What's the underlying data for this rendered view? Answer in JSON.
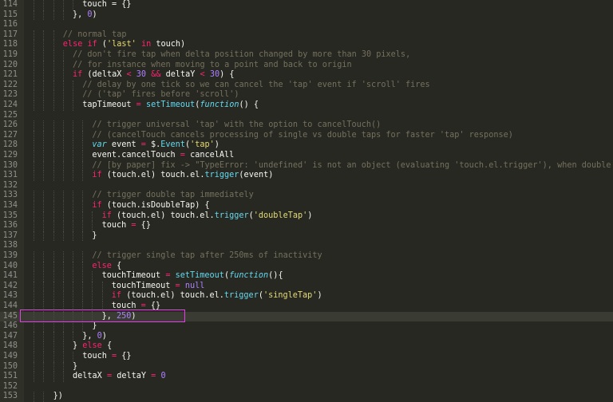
{
  "editor": {
    "theme": {
      "background": "#272822",
      "text": "#f8f8f2",
      "comment": "#75715e",
      "keyword": "#f92672",
      "string": "#e6db74",
      "number": "#ae81ff",
      "function": "#66d9ef",
      "highlight_box": "#e43ee8"
    },
    "lines": [
      {
        "n": "114",
        "i": 6,
        "t": [
          [
            "",
            "touch = {}"
          ]
        ]
      },
      {
        "n": "115",
        "i": 5,
        "t": [
          [
            "",
            "}, "
          ],
          [
            "number",
            "0"
          ],
          [
            "",
            ")"
          ]
        ]
      },
      {
        "n": "116",
        "i": 0,
        "t": []
      },
      {
        "n": "117",
        "i": 4,
        "t": [
          [
            "comment",
            "// normal tap"
          ]
        ]
      },
      {
        "n": "118",
        "i": 4,
        "t": [
          [
            "keyword",
            "else if"
          ],
          [
            "",
            " ("
          ],
          [
            "string",
            "'last'"
          ],
          [
            "",
            " "
          ],
          [
            "keyword",
            "in"
          ],
          [
            "",
            " touch)"
          ]
        ]
      },
      {
        "n": "119",
        "i": 5,
        "t": [
          [
            "comment",
            "// don't fire tap when delta position changed by more than 30 pixels,"
          ]
        ]
      },
      {
        "n": "120",
        "i": 5,
        "t": [
          [
            "comment",
            "// for instance when moving to a point and back to origin"
          ]
        ]
      },
      {
        "n": "121",
        "i": 5,
        "t": [
          [
            "keyword",
            "if"
          ],
          [
            "",
            " (deltaX "
          ],
          [
            "keyword",
            "<"
          ],
          [
            "",
            " "
          ],
          [
            "number",
            "30"
          ],
          [
            "",
            " "
          ],
          [
            "keyword",
            "&&"
          ],
          [
            "",
            " deltaY "
          ],
          [
            "keyword",
            "<"
          ],
          [
            "",
            " "
          ],
          [
            "number",
            "30"
          ],
          [
            "",
            ") {"
          ]
        ]
      },
      {
        "n": "122",
        "i": 6,
        "t": [
          [
            "comment",
            "// delay by one tick so we can cancel the 'tap' event if 'scroll' fires"
          ]
        ]
      },
      {
        "n": "123",
        "i": 6,
        "t": [
          [
            "comment",
            "// ('tap' fires before 'scroll')"
          ]
        ]
      },
      {
        "n": "124",
        "i": 6,
        "t": [
          [
            "",
            "tapTimeout "
          ],
          [
            "keyword",
            "="
          ],
          [
            "",
            " "
          ],
          [
            "func",
            "setTimeout"
          ],
          [
            "",
            "("
          ],
          [
            "storage",
            "function"
          ],
          [
            "",
            "() {"
          ]
        ]
      },
      {
        "n": "125",
        "i": 0,
        "t": []
      },
      {
        "n": "126",
        "i": 7,
        "t": [
          [
            "comment",
            "// trigger universal 'tap' with the option to cancelTouch()"
          ]
        ]
      },
      {
        "n": "127",
        "i": 7,
        "t": [
          [
            "comment",
            "// (cancelTouch cancels processing of single vs double taps for faster 'tap' response)"
          ]
        ]
      },
      {
        "n": "128",
        "i": 7,
        "t": [
          [
            "storage",
            "var"
          ],
          [
            "",
            " event "
          ],
          [
            "keyword",
            "="
          ],
          [
            "",
            " $."
          ],
          [
            "func",
            "Event"
          ],
          [
            "",
            "("
          ],
          [
            "string",
            "'tap'"
          ],
          [
            "",
            ")"
          ]
        ]
      },
      {
        "n": "129",
        "i": 7,
        "t": [
          [
            "",
            "event.cancelTouch "
          ],
          [
            "keyword",
            "="
          ],
          [
            "",
            " cancelAll"
          ]
        ]
      },
      {
        "n": "130",
        "i": 7,
        "t": [
          [
            "comment",
            "// [by paper] fix -> \"TypeError: 'undefined' is not an object (evaluating 'touch.el.trigger'), when double tap"
          ]
        ]
      },
      {
        "n": "131",
        "i": 7,
        "t": [
          [
            "keyword",
            "if"
          ],
          [
            "",
            " (touch.el) touch.el."
          ],
          [
            "func",
            "trigger"
          ],
          [
            "",
            "(event)"
          ]
        ]
      },
      {
        "n": "132",
        "i": 0,
        "t": []
      },
      {
        "n": "133",
        "i": 7,
        "t": [
          [
            "comment",
            "// trigger double tap immediately"
          ]
        ]
      },
      {
        "n": "134",
        "i": 7,
        "t": [
          [
            "keyword",
            "if"
          ],
          [
            "",
            " (touch.isDoubleTap) {"
          ]
        ]
      },
      {
        "n": "135",
        "i": 8,
        "t": [
          [
            "keyword",
            "if"
          ],
          [
            "",
            " (touch.el) touch.el."
          ],
          [
            "func",
            "trigger"
          ],
          [
            "",
            "("
          ],
          [
            "string",
            "'doubleTap'"
          ],
          [
            "",
            ")"
          ]
        ]
      },
      {
        "n": "136",
        "i": 8,
        "t": [
          [
            "",
            "touch "
          ],
          [
            "keyword",
            "="
          ],
          [
            "",
            " {}"
          ]
        ]
      },
      {
        "n": "137",
        "i": 7,
        "t": [
          [
            "",
            "}"
          ]
        ]
      },
      {
        "n": "138",
        "i": 0,
        "t": []
      },
      {
        "n": "139",
        "i": 7,
        "t": [
          [
            "comment",
            "// trigger single tap after 250ms of inactivity"
          ]
        ]
      },
      {
        "n": "140",
        "i": 7,
        "t": [
          [
            "keyword",
            "else"
          ],
          [
            "",
            " {"
          ]
        ]
      },
      {
        "n": "141",
        "i": 8,
        "t": [
          [
            "",
            "touchTimeout "
          ],
          [
            "keyword",
            "="
          ],
          [
            "",
            " "
          ],
          [
            "func",
            "setTimeout"
          ],
          [
            "",
            "("
          ],
          [
            "storage",
            "function"
          ],
          [
            "",
            "(){"
          ]
        ]
      },
      {
        "n": "142",
        "i": 9,
        "t": [
          [
            "",
            "touchTimeout "
          ],
          [
            "keyword",
            "="
          ],
          [
            "",
            " "
          ],
          [
            "number",
            "null"
          ]
        ]
      },
      {
        "n": "143",
        "i": 9,
        "t": [
          [
            "keyword",
            "if"
          ],
          [
            "",
            " (touch.el) touch.el."
          ],
          [
            "func",
            "trigger"
          ],
          [
            "",
            "("
          ],
          [
            "string",
            "'singleTap'"
          ],
          [
            "",
            ")"
          ]
        ]
      },
      {
        "n": "144",
        "i": 9,
        "t": [
          [
            "",
            "touch "
          ],
          [
            "keyword",
            "="
          ],
          [
            "",
            " {}"
          ]
        ]
      },
      {
        "n": "145",
        "i": 8,
        "t": [
          [
            "",
            "}, "
          ],
          [
            "number",
            "250"
          ],
          [
            "",
            ")"
          ]
        ]
      },
      {
        "n": "146",
        "i": 7,
        "t": [
          [
            "",
            "}"
          ]
        ]
      },
      {
        "n": "147",
        "i": 6,
        "t": [
          [
            "",
            "}, "
          ],
          [
            "number",
            "0"
          ],
          [
            "",
            ")"
          ]
        ]
      },
      {
        "n": "148",
        "i": 5,
        "t": [
          [
            "",
            "} "
          ],
          [
            "keyword",
            "else"
          ],
          [
            "",
            " {"
          ]
        ]
      },
      {
        "n": "149",
        "i": 6,
        "t": [
          [
            "",
            "touch "
          ],
          [
            "keyword",
            "="
          ],
          [
            "",
            " {}"
          ]
        ]
      },
      {
        "n": "150",
        "i": 5,
        "t": [
          [
            "",
            "}"
          ]
        ]
      },
      {
        "n": "151",
        "i": 5,
        "t": [
          [
            "",
            "deltaX "
          ],
          [
            "keyword",
            "="
          ],
          [
            "",
            " deltaY "
          ],
          [
            "keyword",
            "="
          ],
          [
            "",
            " "
          ],
          [
            "number",
            "0"
          ]
        ]
      },
      {
        "n": "152",
        "i": 0,
        "t": []
      },
      {
        "n": "153",
        "i": 3,
        "t": [
          [
            "",
            "})"
          ]
        ]
      }
    ],
    "active_line": "145"
  }
}
